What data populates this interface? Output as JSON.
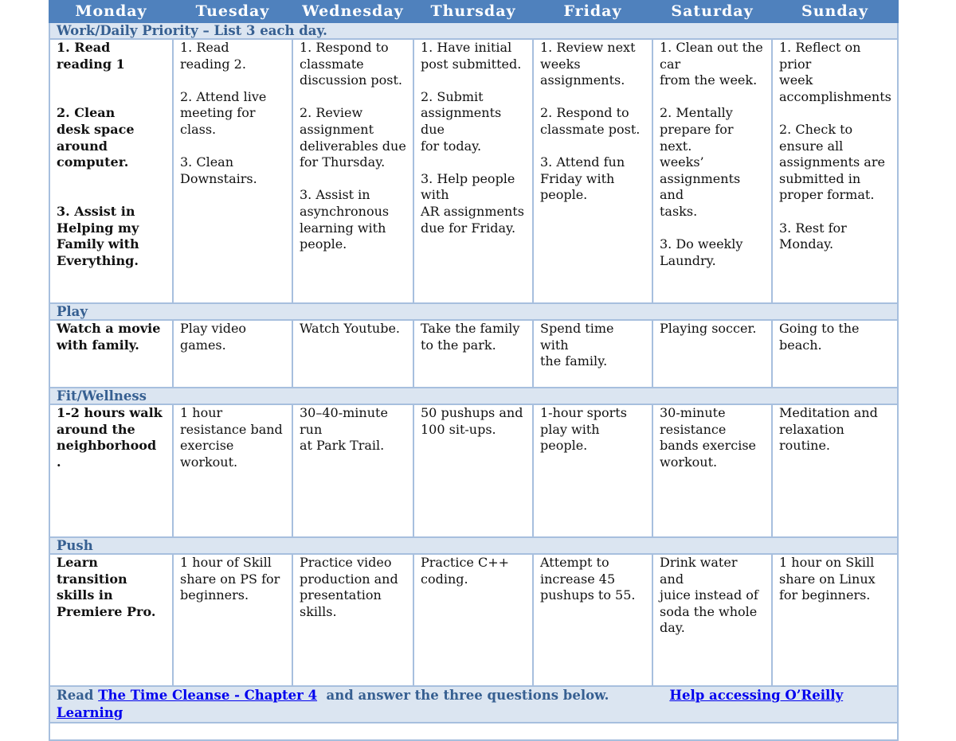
{
  "days": [
    "Monday",
    "Tuesday",
    "Wednesday",
    "Thursday",
    "Friday",
    "Saturday",
    "Sunday"
  ],
  "sections": {
    "work": {
      "title": "Work/Daily Priority – List 3 each day.",
      "cells": [
        [
          "1. Read\nreading 1",
          "",
          "2. Clean\ndesk space\naround\ncomputer.",
          "",
          "3. Assist in\nHelping my\nFamily with\nEverything."
        ],
        [
          "1. Read\nreading 2.",
          "2. Attend live\nmeeting for\nclass.",
          "3. Clean\nDownstairs."
        ],
        [
          "1. Respond to\nclassmate\ndiscussion post.",
          "2. Review\nassignment\ndeliverables due\nfor Thursday.",
          "3. Assist in\nasynchronous\nlearning with\npeople."
        ],
        [
          "1. Have initial\npost submitted.",
          "2. Submit\nassignments\ndue\nfor today.",
          "3. Help people\nwith\nAR assignments\ndue for Friday."
        ],
        [
          "1. Review next\nweeks\nassignments.",
          "2. Respond to\nclassmate post.",
          "3. Attend fun\nFriday with\npeople."
        ],
        [
          "1. Clean out the\ncar\nfrom the week.",
          "2. Mentally\nprepare for\nnext.\nweeks’\nassignments\nand\ntasks.",
          "3. Do weekly\nLaundry."
        ],
        [
          "1. Reflect on\nprior\nweek\naccomplishments",
          "2. Check to\nensure all\nassignments are\nsubmitted in\nproper format.",
          "3. Rest for\nMonday."
        ]
      ]
    },
    "play": {
      "title": "Play",
      "cells": [
        "Watch a movie\nwith family.",
        "Play video\ngames.",
        " Watch Youtube.",
        "Take the family\nto the park.",
        "Spend time with\nthe family.",
        "Playing soccer.",
        "Going to the\nbeach."
      ]
    },
    "fit": {
      "title": "Fit/Wellness",
      "cells": [
        "1-2 hours walk\naround the\nneighborhood\n.",
        "1 hour\nresistance band\nexercise\nworkout.",
        " 30–40-minute\nrun\nat Park Trail.",
        "50 pushups and\n100 sit-ups.",
        "1-hour sports\nplay with\npeople.",
        "30-minute\nresistance\nbands exercise\nworkout.",
        "Meditation and\nrelaxation\nroutine."
      ]
    },
    "push": {
      "title": "Push",
      "cells": [
        "Learn\ntransition\nskills in\nPremiere Pro.",
        "1 hour of Skill\nshare on PS for\nbeginners.",
        "Practice video\nproduction and\npresentation\nskills.",
        "Practice C++\ncoding.",
        "Attempt to\nincrease 45\npushups to 55.",
        "Drink water and\njuice instead of\nsoda the whole\nday.",
        "1 hour on Skill\nshare on Linux\nfor beginners."
      ]
    }
  },
  "footer": {
    "prefix": "Read ",
    "reading_link": "The Time Cleanse - Chapter 4",
    "middle": "  and answer the three questions below.",
    "help_link": "Help accessing O’Reilly Learning"
  },
  "colors": {
    "header_bg": "#4f81bd",
    "section_bg": "#dbe5f1",
    "section_text": "#365f91",
    "border": "#a7bfde",
    "link": "#0000ee"
  }
}
